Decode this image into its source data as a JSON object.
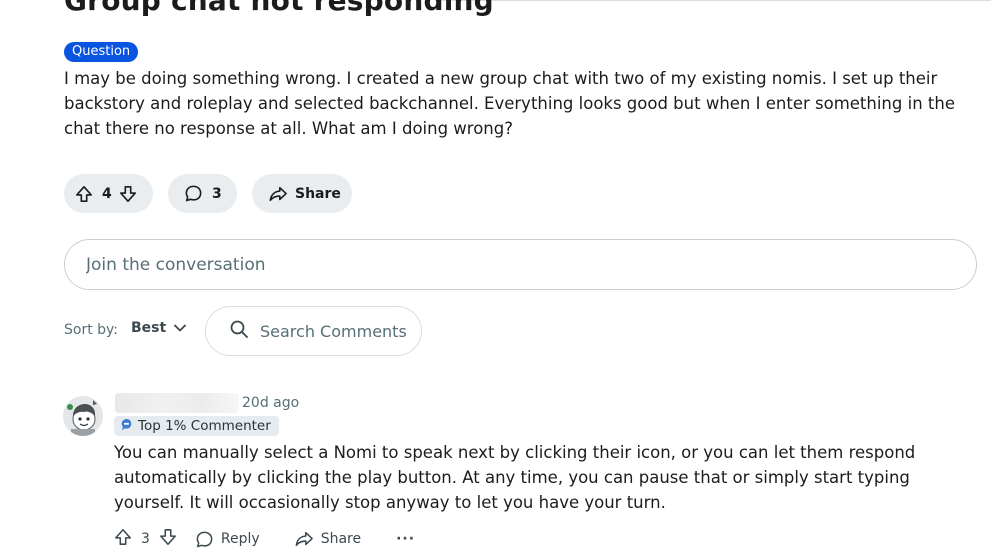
{
  "post": {
    "title": "Group chat not responding",
    "flair": "Question",
    "body": "I may be doing something wrong. I created a new group chat with two of my existing nomis. I set up their backstory and roleplay and selected backchannel. Everything looks good but when I enter something in the chat there no response at all. What am I doing wrong?",
    "vote_count": "4",
    "comment_count": "3",
    "share_label": "Share"
  },
  "composer": {
    "placeholder": "Join the conversation"
  },
  "sort": {
    "label": "Sort by:",
    "selected": "Best"
  },
  "search": {
    "placeholder": "Search Comments"
  },
  "comments": [
    {
      "timestamp": "20d ago",
      "badge": "Top 1% Commenter",
      "body": "You can manually select a Nomi to speak next by clicking their icon, or you can let them respond automatically by clicking the play button. At any time, you can pause that or simply start typing yourself. It will occasionally stop anyway to let you have your turn.",
      "vote_count": "3",
      "reply_label": "Reply",
      "share_label": "Share",
      "more_label": "···"
    }
  ],
  "colors": {
    "flair_bg": "#0a55e0",
    "pill_bg": "#e9edef",
    "muted_text": "#576f76"
  },
  "icons": {
    "upvote": "arrow-up-icon",
    "downvote": "arrow-down-icon",
    "comment": "speech-bubble-icon",
    "share": "share-arrow-icon",
    "search": "search-icon",
    "chevron": "chevron-down-icon",
    "badge": "comment-badge-icon"
  }
}
